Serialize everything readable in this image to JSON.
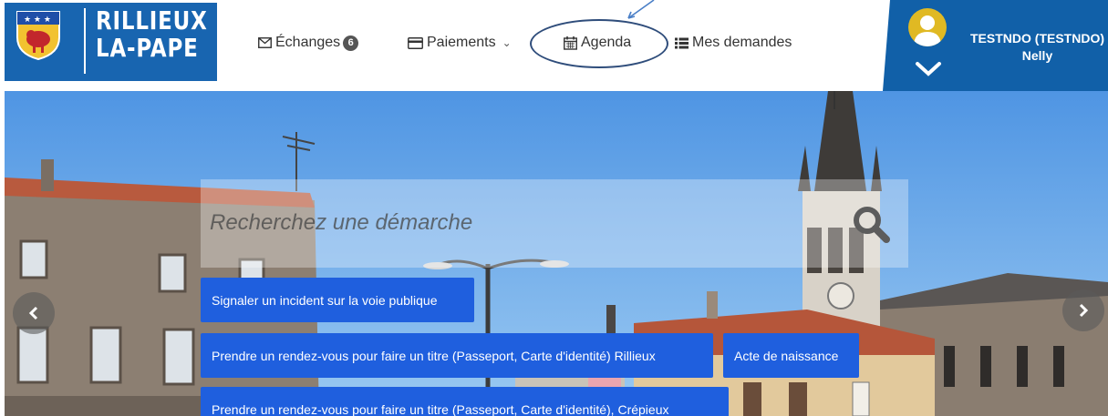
{
  "header": {
    "logo_line1": "RILLIEUX",
    "logo_line2": "LA-PAPE",
    "nav": {
      "echanges_label": "Échanges",
      "echanges_count": "6",
      "paiements_label": "Paiements",
      "agenda_label": "Agenda",
      "demandes_label": "Mes demandes"
    },
    "user": {
      "line1": "TESTNDO (TESTNDO)",
      "line2": "Nelly"
    }
  },
  "hero": {
    "search_placeholder": "Recherchez une démarche",
    "quick_actions": [
      "Signaler un incident sur la voie publique",
      "Prendre un rendez-vous pour faire un titre (Passeport, Carte d'identité) Rillieux",
      "Acte de naissance",
      "Prendre un rendez-vous pour faire un titre (Passeport, Carte d'identité), Crépieux"
    ]
  },
  "colors": {
    "brand_blue": "#1865b0",
    "user_panel": "#1160a8",
    "action_button": "#1f5fde",
    "annotation": "#2f4d7b"
  },
  "icons": [
    "crest-logo",
    "envelope-icon",
    "credit-card-icon",
    "calendar-icon",
    "list-icon",
    "chevron-down-icon",
    "user-avatar-icon",
    "search-icon",
    "chevron-left-icon",
    "chevron-right-icon"
  ]
}
